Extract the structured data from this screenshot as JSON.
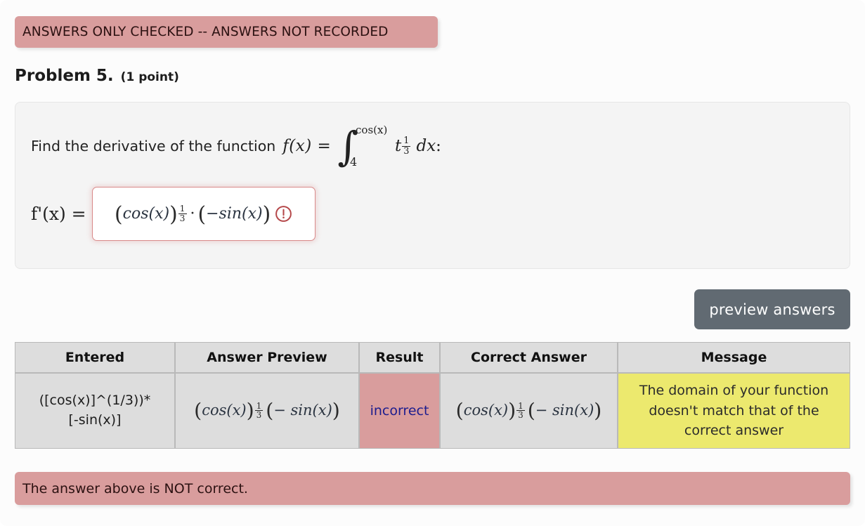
{
  "page": {
    "background_color": "#fcfcfc"
  },
  "top_alert": {
    "text": "ANSWERS ONLY CHECKED -- ANSWERS NOT RECORDED",
    "background_color": "#d99d9d",
    "text_color": "#2b1111"
  },
  "heading": {
    "title": "Problem 5.",
    "points": "(1 point)"
  },
  "problem": {
    "prompt_text": "Find the derivative of the function",
    "function_label": "f(x) =",
    "integral": {
      "upper_limit": "cos(x)",
      "lower_limit": "4",
      "integrand_base": "t",
      "integrand_exponent_num": "1",
      "integrand_exponent_den": "3",
      "differential": "dx",
      "trailing_colon": ":"
    },
    "answer_field": {
      "label": "f'(x) =",
      "value_base": "cos(x)",
      "value_exponent_num": "1",
      "value_exponent_den": "3",
      "multiplication_dot": "·",
      "value_factor": "−sin(x)",
      "status_icon": "warning-exclamation-circle-icon",
      "border_color": "#d98a8a",
      "icon_color": "#b5484a"
    }
  },
  "toolbar": {
    "preview_label": "preview answers",
    "preview_bg_color": "#616a72"
  },
  "results": {
    "headers": [
      "Entered",
      "Answer Preview",
      "Result",
      "Correct Answer",
      "Message"
    ],
    "row": {
      "entered_line1": "([cos(x)]^(1/3))*",
      "entered_line2": "[-sin(x)]",
      "answer_preview": {
        "base": "cos(x)",
        "exponent_num": "1",
        "exponent_den": "3",
        "factor": "− sin(x)"
      },
      "result": "incorrect",
      "result_bg_color": "#d99d9d",
      "result_text_color": "#1c1c8e",
      "correct_answer": {
        "base": "cos(x)",
        "exponent_num": "1",
        "exponent_den": "3",
        "factor": "− sin(x)"
      },
      "message_line1": "The domain of your function",
      "message_line2": "doesn't match that of the",
      "message_line3": "correct answer",
      "message_bg_color": "#ece96e"
    }
  },
  "bottom_alert": {
    "text": "The answer above is NOT correct.",
    "background_color": "#d99d9d",
    "text_color": "#2b1111"
  }
}
